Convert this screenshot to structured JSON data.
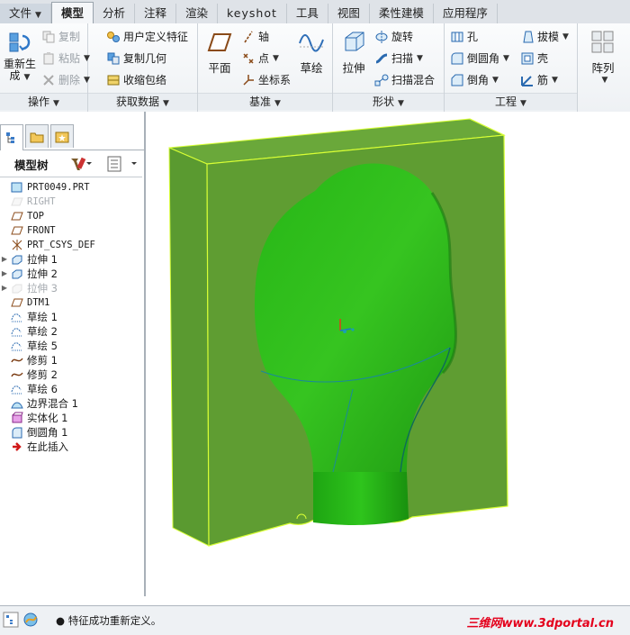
{
  "tabs": [
    {
      "label": "文件",
      "caret": "▼"
    },
    {
      "label": "模型"
    },
    {
      "label": "分析"
    },
    {
      "label": "注释"
    },
    {
      "label": "渲染"
    },
    {
      "label": "keyshot"
    },
    {
      "label": "工具"
    },
    {
      "label": "视图"
    },
    {
      "label": "柔性建模"
    },
    {
      "label": "应用程序"
    }
  ],
  "ribbon": {
    "operations": {
      "label": "操作",
      "regen_line1": "重新生",
      "regen_line2": "成",
      "copy": "复制",
      "paste": "粘贴",
      "delete": "删除"
    },
    "get_data": {
      "label": "获取数据",
      "udf": "用户定义特征",
      "copy_geom": "复制几何",
      "shrinkwrap": "收缩包络"
    },
    "datum": {
      "label": "基准",
      "plane": "平面",
      "axis": "轴",
      "point": "点",
      "csys": "坐标系",
      "sketch": "草绘"
    },
    "shapes": {
      "label": "形状",
      "extrude": "拉伸",
      "revolve": "旋转",
      "sweep": "扫描",
      "swept_blend": "扫描混合"
    },
    "engineering": {
      "label": "工程",
      "hole": "孔",
      "round": "倒圆角",
      "chamfer": "倒角",
      "draft": "拔模",
      "shell": "壳",
      "rib": "筋"
    },
    "pattern": {
      "label": "阵列"
    }
  },
  "model_tree": {
    "title": "模型树",
    "items": [
      {
        "label": "PRT0049.PRT",
        "gray": false,
        "expander": "",
        "mono": true
      },
      {
        "label": "RIGHT",
        "gray": true,
        "expander": "",
        "mono": true
      },
      {
        "label": "TOP",
        "gray": false,
        "expander": "",
        "mono": true
      },
      {
        "label": "FRONT",
        "gray": false,
        "expander": "",
        "mono": true
      },
      {
        "label": "PRT_CSYS_DEF",
        "gray": false,
        "expander": "",
        "mono": true
      },
      {
        "label": "拉伸 1",
        "gray": false,
        "expander": "▶",
        "mono": false
      },
      {
        "label": "拉伸 2",
        "gray": false,
        "expander": "▶",
        "mono": false
      },
      {
        "label": "拉伸 3",
        "gray": true,
        "expander": "▶",
        "mono": false
      },
      {
        "label": "DTM1",
        "gray": false,
        "expander": "",
        "mono": true
      },
      {
        "label": "草绘 1",
        "gray": false,
        "expander": "",
        "mono": false
      },
      {
        "label": "草绘 2",
        "gray": false,
        "expander": "",
        "mono": false
      },
      {
        "label": "草绘 5",
        "gray": false,
        "expander": "",
        "mono": false
      },
      {
        "label": "修剪 1",
        "gray": false,
        "expander": "",
        "mono": false
      },
      {
        "label": "修剪 2",
        "gray": false,
        "expander": "",
        "mono": false
      },
      {
        "label": "草绘 6",
        "gray": false,
        "expander": "",
        "mono": false
      },
      {
        "label": "边界混合 1",
        "gray": false,
        "expander": "",
        "mono": false
      },
      {
        "label": "实体化 1",
        "gray": false,
        "expander": "",
        "mono": false
      },
      {
        "label": "倒圆角 1",
        "gray": false,
        "expander": "",
        "mono": false
      },
      {
        "label": "在此插入",
        "gray": false,
        "expander": "",
        "mono": false
      }
    ]
  },
  "status": {
    "message": "● 特征成功重新定义。",
    "watermark": "三维网www.3dportal.cn"
  },
  "colors": {
    "model_green": "#5a9d2e",
    "cavity_green": "#2fbf1c",
    "edge_yellow": "#d8ff35"
  }
}
